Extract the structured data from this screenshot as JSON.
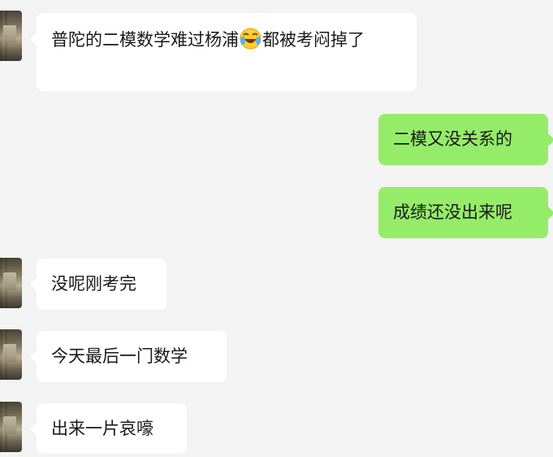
{
  "colors": {
    "background": "#f3f3f3",
    "incoming_bubble": "#ffffff",
    "outgoing_bubble": "#95ec69",
    "text": "#191919"
  },
  "messages": [
    {
      "side": "left",
      "text_before_emoji": "普陀的二模数学难过杨浦",
      "emoji": "crying-laughing-emoji",
      "text_after_emoji": "都被考闷掉了"
    },
    {
      "side": "right",
      "text": "二模又没关系的"
    },
    {
      "side": "right",
      "text": "成绩还没出来呢"
    },
    {
      "side": "left",
      "text": "没呢刚考完"
    },
    {
      "side": "left",
      "text": "今天最后一门数学"
    },
    {
      "side": "left",
      "text": "出来一片哀嚎"
    }
  ]
}
